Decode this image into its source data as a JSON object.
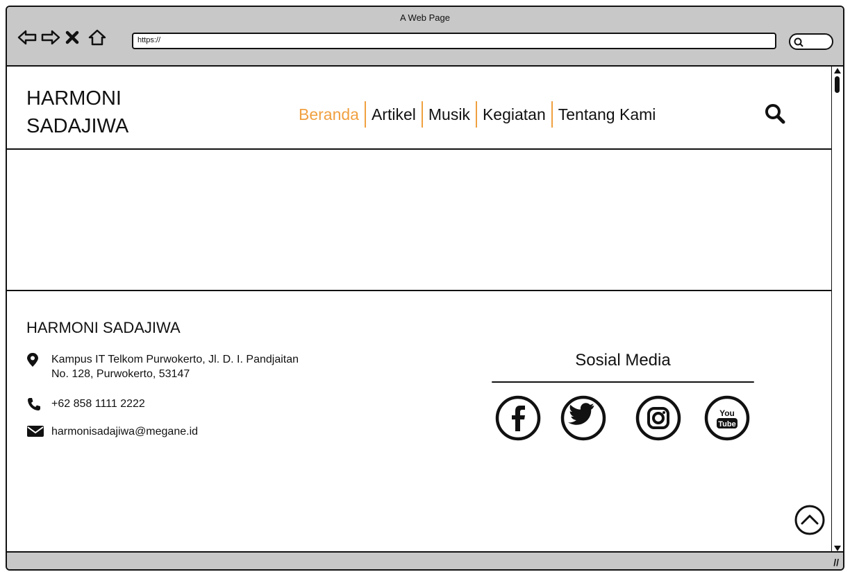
{
  "browser": {
    "window_title": "A Web Page",
    "url": "https://",
    "icons": [
      "back-arrow-icon",
      "forward-arrow-icon",
      "close-x-icon",
      "home-icon",
      "search-icon"
    ]
  },
  "header": {
    "logo_line1": "HARMONI",
    "logo_line2": "SADAJIWA",
    "menu": [
      {
        "label": "Beranda",
        "active": true
      },
      {
        "label": "Artikel",
        "active": false
      },
      {
        "label": "Musik",
        "active": false
      },
      {
        "label": "Kegiatan",
        "active": false
      },
      {
        "label": "Tentang Kami",
        "active": false
      }
    ],
    "accent_color": "#f0a040",
    "search_icon": "search-icon"
  },
  "footer": {
    "title": "HARMONI SADAJIWA",
    "address_line1": "Kampus IT Telkom Purwokerto, Jl. D. I. Pandjaitan",
    "address_line2": "No. 128, Purwokerto, 53147",
    "phone": "+62 858 1111 2222",
    "email": "harmonisadajiwa@megane.id",
    "social_title": "Sosial Media",
    "social_icons": [
      "facebook-icon",
      "twitter-icon",
      "instagram-icon",
      "youtube-icon"
    ],
    "youtube_text_top": "You",
    "youtube_text_bottom": "Tube"
  }
}
